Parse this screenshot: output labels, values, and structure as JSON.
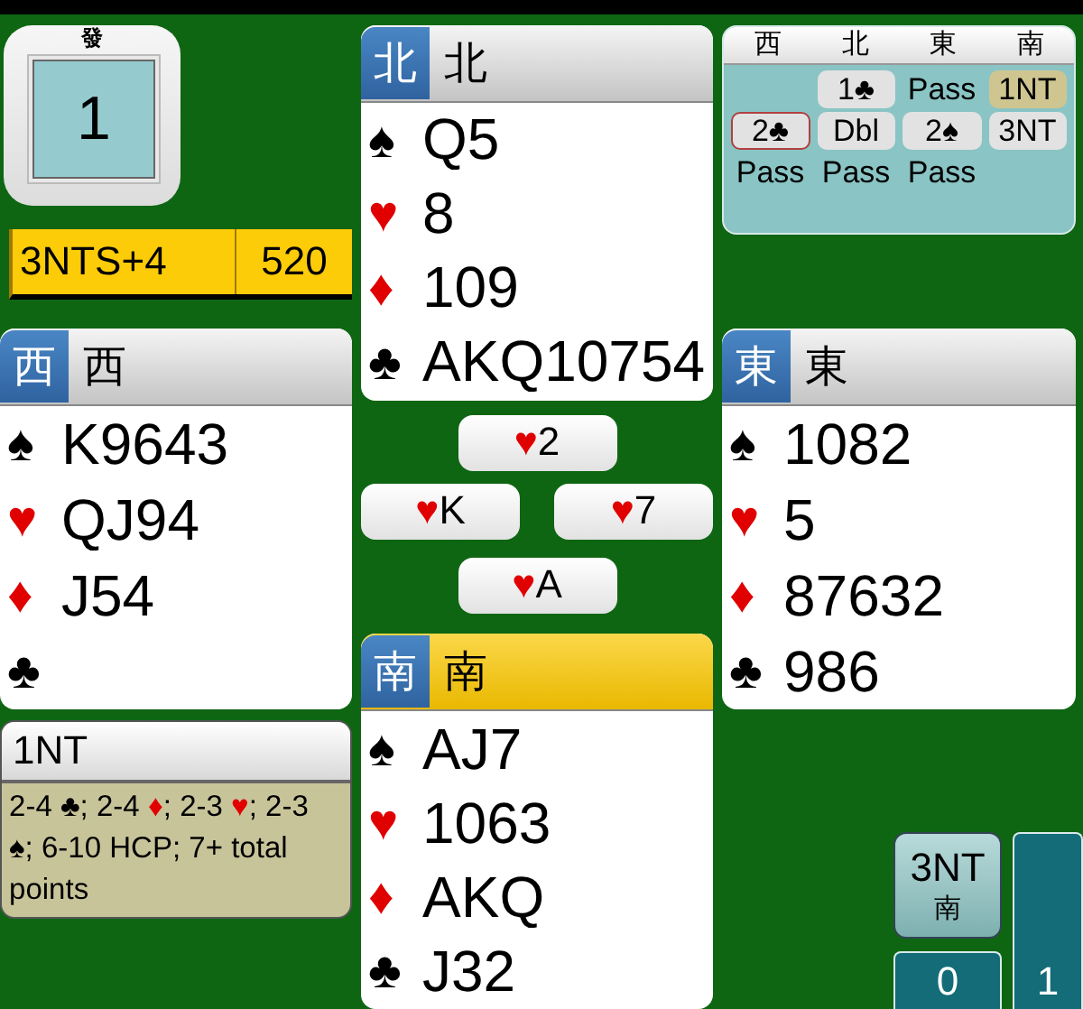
{
  "board": {
    "dealer": "發",
    "number": "1"
  },
  "result": {
    "contract": "3NTS+4",
    "score": "520"
  },
  "hands": [
    {
      "kind": "north",
      "seat": "北",
      "name": "北",
      "active": false,
      "suits": [
        {
          "kind": "spade",
          "symbol": "♠",
          "cards": "Q5"
        },
        {
          "kind": "heart",
          "symbol": "♥",
          "cards": "8"
        },
        {
          "kind": "diamond",
          "symbol": "♦",
          "cards": "109"
        },
        {
          "kind": "club",
          "symbol": "♣",
          "cards": "AKQ10754"
        }
      ]
    },
    {
      "kind": "west",
      "seat": "西",
      "name": "西",
      "active": false,
      "suits": [
        {
          "kind": "spade",
          "symbol": "♠",
          "cards": "K9643"
        },
        {
          "kind": "heart",
          "symbol": "♥",
          "cards": "QJ94"
        },
        {
          "kind": "diamond",
          "symbol": "♦",
          "cards": "J54"
        },
        {
          "kind": "club",
          "symbol": "♣"
        }
      ]
    },
    {
      "kind": "east",
      "seat": "東",
      "name": "東",
      "active": false,
      "suits": [
        {
          "kind": "spade",
          "symbol": "♠",
          "cards": "1082"
        },
        {
          "kind": "heart",
          "symbol": "♥",
          "cards": "5"
        },
        {
          "kind": "diamond",
          "symbol": "♦",
          "cards": "87632"
        },
        {
          "kind": "club",
          "symbol": "♣",
          "cards": "986"
        }
      ]
    },
    {
      "kind": "south",
      "seat": "南",
      "name": "南",
      "active": true,
      "suits": [
        {
          "kind": "spade",
          "symbol": "♠",
          "cards": "AJ7"
        },
        {
          "kind": "heart",
          "symbol": "♥",
          "cards": "1063"
        },
        {
          "kind": "diamond",
          "symbol": "♦",
          "cards": "AKQ"
        },
        {
          "kind": "club",
          "symbol": "♣",
          "cards": "J32"
        }
      ]
    }
  ],
  "trick": [
    {
      "kind": "north",
      "symbol": "♥",
      "rank": "2"
    },
    {
      "kind": "west",
      "symbol": "♥",
      "rank": "K"
    },
    {
      "kind": "east",
      "symbol": "♥",
      "rank": "7"
    },
    {
      "kind": "south",
      "symbol": "♥",
      "rank": "A"
    }
  ],
  "auction": {
    "seats": [
      "西",
      "北",
      "東",
      "南"
    ],
    "calls": [
      {
        "kind": "blank"
      },
      {
        "kind": "bid",
        "text": "1♣",
        "selected": false,
        "alerted": false
      },
      {
        "kind": "pass",
        "text": "Pass",
        "selected": false,
        "alerted": false
      },
      {
        "kind": "bid",
        "text": "1NT",
        "selected": true,
        "alerted": false
      },
      {
        "kind": "bid",
        "text": "2♣",
        "selected": false,
        "alerted": true
      },
      {
        "kind": "bid",
        "text": "Dbl",
        "selected": false,
        "alerted": false
      },
      {
        "kind": "bid",
        "text": "2♠",
        "selected": false,
        "alerted": false
      },
      {
        "kind": "bid",
        "text": "3NT",
        "selected": false,
        "alerted": false
      },
      {
        "kind": "pass",
        "text": "Pass",
        "selected": false,
        "alerted": false
      },
      {
        "kind": "pass",
        "text": "Pass",
        "selected": false,
        "alerted": false
      },
      {
        "kind": "pass",
        "text": "Pass",
        "selected": false,
        "alerted": false
      }
    ]
  },
  "explanation": {
    "bid": "1NT",
    "meaning": "2-4 ♣; 2-4 ♦; 2-3 ♥; 2-3 ♠; 6-10 HCP; 7+ total points"
  },
  "contract_badge": {
    "contract": "3NT",
    "declarer": "南"
  },
  "tricks": {
    "ns": "0",
    "ew": "1"
  }
}
